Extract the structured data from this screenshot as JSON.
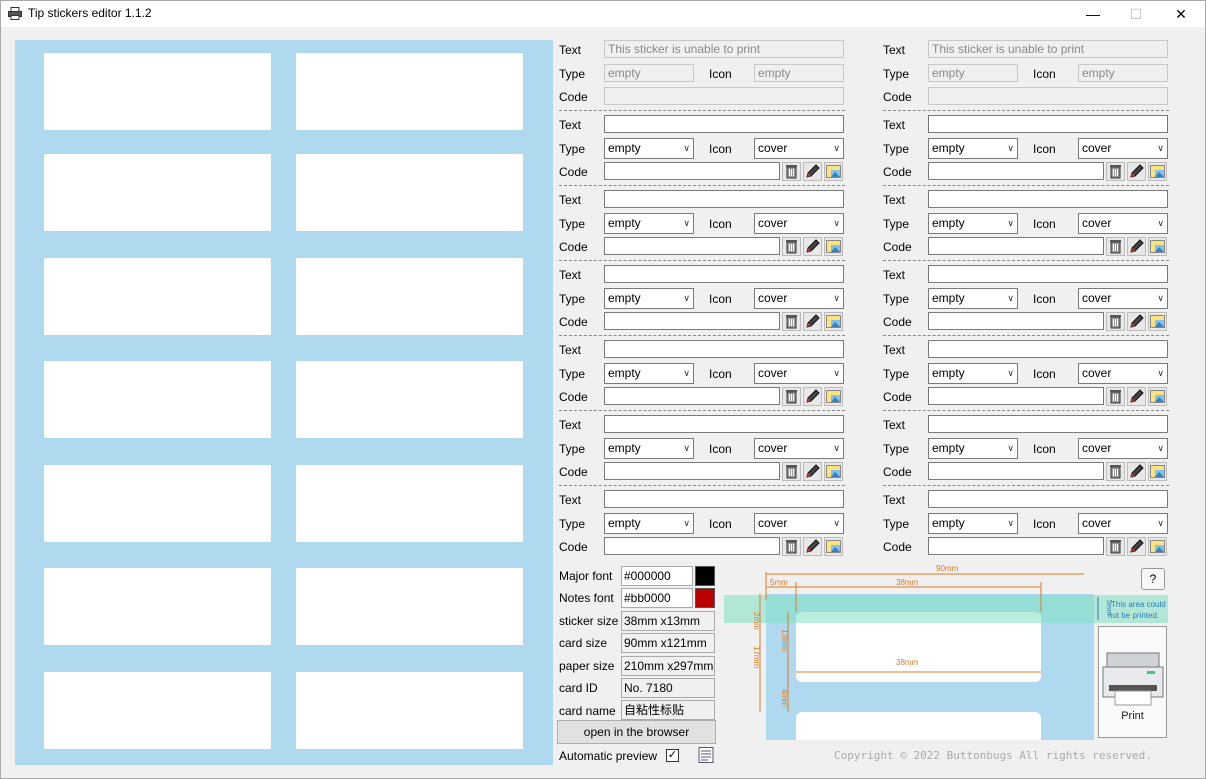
{
  "window": {
    "title": "Tip stickers editor 1.1.2"
  },
  "labels": {
    "text": "Text",
    "type": "Type",
    "icon": "Icon",
    "code": "Code"
  },
  "columns": [
    {
      "disabled": {
        "text": "This sticker is unable to print",
        "type": "empty",
        "icon": "empty",
        "code": ""
      },
      "entries": [
        {
          "text": "",
          "type": "empty",
          "icon": "cover",
          "code": ""
        },
        {
          "text": "",
          "type": "empty",
          "icon": "cover",
          "code": ""
        },
        {
          "text": "",
          "type": "empty",
          "icon": "cover",
          "code": ""
        },
        {
          "text": "",
          "type": "empty",
          "icon": "cover",
          "code": ""
        },
        {
          "text": "",
          "type": "empty",
          "icon": "cover",
          "code": ""
        },
        {
          "text": "",
          "type": "empty",
          "icon": "cover",
          "code": ""
        }
      ]
    },
    {
      "disabled": {
        "text": "This sticker is unable to print",
        "type": "empty",
        "icon": "empty",
        "code": ""
      },
      "entries": [
        {
          "text": "",
          "type": "empty",
          "icon": "cover",
          "code": ""
        },
        {
          "text": "",
          "type": "empty",
          "icon": "cover",
          "code": ""
        },
        {
          "text": "",
          "type": "empty",
          "icon": "cover",
          "code": ""
        },
        {
          "text": "",
          "type": "empty",
          "icon": "cover",
          "code": ""
        },
        {
          "text": "",
          "type": "empty",
          "icon": "cover",
          "code": ""
        },
        {
          "text": "",
          "type": "empty",
          "icon": "cover",
          "code": ""
        }
      ]
    }
  ],
  "settings": {
    "major_font_label": "Major font",
    "major_font_value": "#000000",
    "major_font_color": "#000000",
    "notes_font_label": "Notes font",
    "notes_font_value": "#bb0000",
    "notes_font_color": "#bb0000",
    "sticker_size_label": "sticker size",
    "sticker_size_value": "38mm x13mm",
    "card_size_label": "card size",
    "card_size_value": "90mm x121mm",
    "paper_size_label": "paper size",
    "paper_size_value": "210mm x297mm",
    "card_id_label": "card ID",
    "card_id_value": "No. 7180",
    "card_name_label": "card name",
    "card_name_value": "自粘性标贴",
    "browser_button": "open in the browser",
    "auto_preview_label": "Automatic preview",
    "auto_preview_checked": true
  },
  "diagram": {
    "width_label": "90mm",
    "margin_label": "5mm",
    "sticker_width_label": "38mm",
    "top_margin_label": "2mm",
    "sticker_height_label": "13mm",
    "row_pitch_label": "17mm",
    "gap_label": "4mm",
    "inner_width_label": "38mm",
    "unprintable_height_label": "5mm",
    "unprintable_note_1": "This area could",
    "unprintable_note_2": "not be printed.",
    "help": "?",
    "print_label": "Print",
    "accent_color": "#e07a22",
    "band_color": "#7fe0c4"
  },
  "footer": {
    "copyright": "Copyright © 2022 Buttonbugs All rights reserved."
  },
  "colors": {
    "preview_background": "#afd9ee"
  }
}
